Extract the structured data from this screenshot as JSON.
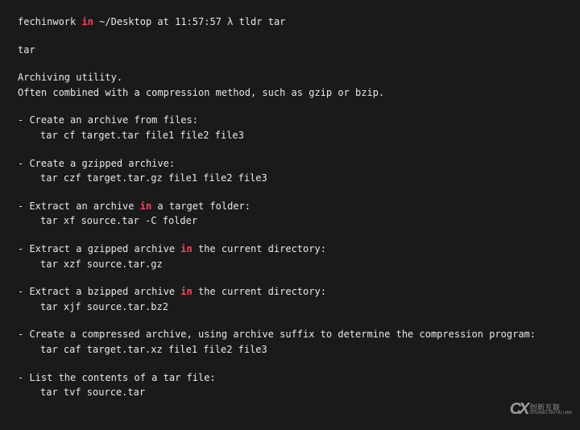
{
  "prompt": {
    "user": "fechinwork",
    "in": "in",
    "path": "~/Desktop at 11:57:57",
    "lambda": "λ",
    "command": "tldr tar"
  },
  "cmdName": "tar",
  "description": {
    "line1": "Archiving utility.",
    "line2": "Often combined with a compression method, such as gzip or bzip."
  },
  "entries": [
    {
      "title_pre": "- Create an archive from files:",
      "title_hl": "",
      "title_post": "",
      "cmd": "tar cf target.tar file1 file2 file3"
    },
    {
      "title_pre": "- Create a gzipped archive:",
      "title_hl": "",
      "title_post": "",
      "cmd": "tar czf target.tar.gz file1 file2 file3"
    },
    {
      "title_pre": "- Extract an archive ",
      "title_hl": "in",
      "title_post": " a target folder:",
      "cmd": "tar xf source.tar -C folder"
    },
    {
      "title_pre": "- Extract a gzipped archive ",
      "title_hl": "in",
      "title_post": " the current directory:",
      "cmd": "tar xzf source.tar.gz"
    },
    {
      "title_pre": "- Extract a bzipped archive ",
      "title_hl": "in",
      "title_post": " the current directory:",
      "cmd": "tar xjf source.tar.bz2"
    },
    {
      "title_pre": "- Create a compressed archive, using archive suffix to determine the compression program:",
      "title_hl": "",
      "title_post": "",
      "cmd": "tar caf target.tar.xz file1 file2 file3"
    },
    {
      "title_pre": "- List the contents of a tar file:",
      "title_hl": "",
      "title_post": "",
      "cmd": "tar tvf source.tar"
    }
  ],
  "watermark": {
    "logo": "CX",
    "line1": "创新互联",
    "line2": "CHUANG XIN HU LIAN"
  }
}
